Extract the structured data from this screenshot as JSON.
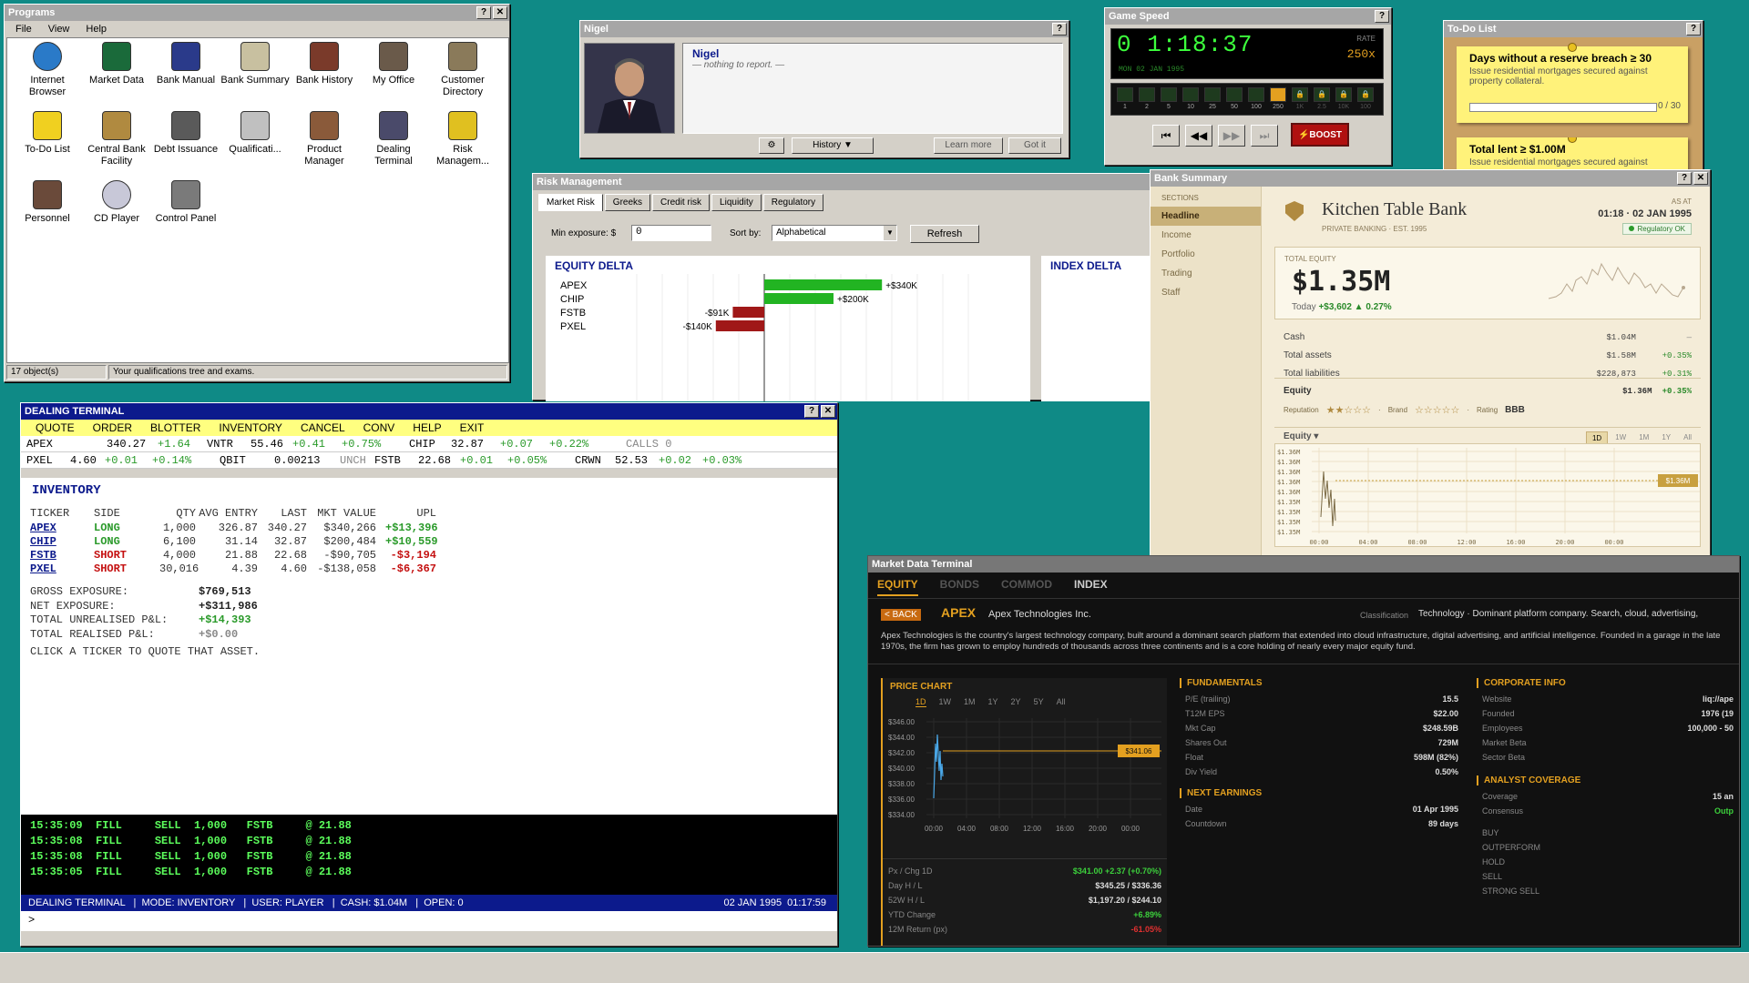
{
  "programs": {
    "title": "Programs",
    "menu": [
      "File",
      "View",
      "Help"
    ],
    "icons": [
      {
        "label": "Internet Browser",
        "icon": "globe-icon"
      },
      {
        "label": "Market Data",
        "icon": "chart-icon"
      },
      {
        "label": "Bank Manual",
        "icon": "book-icon"
      },
      {
        "label": "Bank Summary",
        "icon": "clipboard-icon"
      },
      {
        "label": "Bank History",
        "icon": "history-icon"
      },
      {
        "label": "My Office",
        "icon": "office-icon"
      },
      {
        "label": "Customer Directory",
        "icon": "directory-icon"
      },
      {
        "label": "To-Do List",
        "icon": "note-icon"
      },
      {
        "label": "Central Bank Facility",
        "icon": "bank-icon"
      },
      {
        "label": "Debt Issuance",
        "icon": "debt-icon"
      },
      {
        "label": "Qualificati...",
        "icon": "qualification-icon"
      },
      {
        "label": "Product Manager",
        "icon": "boxes-icon"
      },
      {
        "label": "Dealing Terminal",
        "icon": "terminal-icon"
      },
      {
        "label": "Risk Managem...",
        "icon": "shield-icon"
      },
      {
        "label": "Personnel",
        "icon": "people-icon"
      },
      {
        "label": "CD Player",
        "icon": "cd-icon"
      },
      {
        "label": "Control Panel",
        "icon": "gear-icon"
      }
    ],
    "status_count": "17 object(s)",
    "status_text": "Your qualifications tree and exams."
  },
  "nigel": {
    "title": "Nigel",
    "name": "Nigel",
    "message": "— nothing to report. —",
    "history": "History ▼",
    "learn": "Learn more",
    "gotit": "Got it"
  },
  "speed": {
    "title": "Game Speed",
    "time": "0 1:18:37",
    "date": "MON 02 JAN 1995",
    "rate_label": "RATE",
    "rate": "250x",
    "ticks": [
      "1",
      "2",
      "5",
      "10",
      "25",
      "50",
      "100",
      "250",
      "1K",
      "2.5",
      "10K",
      "100"
    ],
    "boost": "⚡BOOST"
  },
  "todo": {
    "title": "To-Do List",
    "item1_title": "Days without a reserve breach ≥ 30",
    "item1_desc": "Issue residential mortgages secured against property collateral.",
    "item1_progress": "0 / 30",
    "item2_title": "Total lent ≥ $1.00M",
    "item2_desc": "Issue residential mortgages secured against"
  },
  "risk": {
    "title": "Risk Management",
    "tabs": [
      "Market Risk",
      "Greeks",
      "Credit risk",
      "Liquidity",
      "Regulatory"
    ],
    "min_exposure_label": "Min exposure: $",
    "min_exposure": "0",
    "sort_label": "Sort by:",
    "sort_value": "Alphabetical",
    "refresh": "Refresh",
    "equity_title": "EQUITY DELTA",
    "index_title": "INDEX DELTA",
    "bars": [
      {
        "name": "APEX",
        "label": "+$340K",
        "value": 340
      },
      {
        "name": "CHIP",
        "label": "+$200K",
        "value": 200
      },
      {
        "name": "FSTB",
        "label": "-$91K",
        "value": -91
      },
      {
        "name": "PXEL",
        "label": "-$140K",
        "value": -140
      }
    ]
  },
  "bank": {
    "title": "Bank Summary",
    "sections_label": "SECTIONS",
    "sections": [
      "Headline",
      "Income",
      "Portfolio",
      "Trading",
      "Staff"
    ],
    "name": "Kitchen Table Bank",
    "subtitle": "PRIVATE BANKING · EST. 1995",
    "as_at_label": "AS AT",
    "as_at": "01:18 · 02 JAN 1995",
    "regulatory": "Regulatory OK",
    "total_equity_label": "TOTAL EQUITY",
    "total_equity": "$1.35M",
    "today_label": "Today",
    "today": "+$3,602 ▲ 0.27%",
    "rows": [
      {
        "k": "Cash",
        "v": "$1.04M",
        "c": "—"
      },
      {
        "k": "Total assets",
        "v": "$1.58M",
        "c": "+0.35%"
      },
      {
        "k": "Total liabilities",
        "v": "$228,873",
        "c": "+0.31%"
      }
    ],
    "equity_label": "Equity",
    "equity_v": "$1.36M",
    "equity_c": "+0.35%",
    "reputation_label": "Reputation",
    "reputation_stars": "★★☆☆☆",
    "brand_label": "Brand",
    "brand_stars": "☆☆☆☆☆",
    "rating_label": "Rating",
    "rating": "BBB",
    "chart_label": "Equity ▾",
    "ranges": [
      "1D",
      "1W",
      "1M",
      "1Y",
      "All"
    ],
    "y_ticks": [
      "$1.36M",
      "$1.36M",
      "$1.36M",
      "$1.36M",
      "$1.36M",
      "$1.35M",
      "$1.35M",
      "$1.35M",
      "$1.35M"
    ],
    "x_ticks": [
      "00:00",
      "04:00",
      "08:00",
      "12:00",
      "16:00",
      "20:00",
      "00:00"
    ],
    "last_tag": "$1.36M"
  },
  "dealing": {
    "title": "DEALING TERMINAL",
    "menu": [
      "QUOTE",
      "ORDER",
      "BLOTTER",
      "INVENTORY",
      "CANCEL",
      "CONV",
      "HELP",
      "EXIT"
    ],
    "quotes1": [
      "APEX",
      "340.27",
      "+1.64",
      "VNTR",
      "55.46",
      "+0.41",
      "+0.75%",
      "CHIP",
      "32.87",
      "+0.07",
      "+0.22%",
      "CALLS 0"
    ],
    "quotes2": [
      "PXEL",
      "4.60",
      "+0.01",
      "+0.14%",
      "QBIT",
      "0.00213",
      "UNCH",
      "FSTB",
      "22.68",
      "+0.01",
      "+0.05%",
      "CRWN",
      "52.53",
      "+0.02",
      "+0.03%"
    ],
    "inv_title": "INVENTORY",
    "headers": [
      "TICKER",
      "SIDE",
      "QTY",
      "AVG ENTRY",
      "LAST",
      "MKT VALUE",
      "UPL"
    ],
    "rows": [
      [
        "APEX",
        "LONG",
        "1,000",
        "326.87",
        "340.27",
        "$340,266",
        "+$13,396"
      ],
      [
        "CHIP",
        "LONG",
        "6,100",
        "31.14",
        "32.87",
        "$200,484",
        "+$10,559"
      ],
      [
        "FSTB",
        "SHORT",
        "4,000",
        "21.88",
        "22.68",
        "-$90,705",
        "-$3,194"
      ],
      [
        "PXEL",
        "SHORT",
        "30,016",
        "4.39",
        "4.60",
        "-$138,058",
        "-$6,367"
      ]
    ],
    "gross_label": "GROSS EXPOSURE:",
    "gross": "$769,513",
    "net_label": "NET EXPOSURE:",
    "net": "+$311,986",
    "unreal_label": "TOTAL UNREALISED P&L:",
    "unreal": "+$14,393",
    "real_label": "TOTAL REALISED P&L:",
    "real": "+$0.00",
    "hint": "CLICK A TICKER TO QUOTE THAT ASSET.",
    "log": [
      "15:35:09  FILL     SELL  1,000   FSTB     @ 21.88",
      "15:35:08  FILL     SELL  1,000   FSTB     @ 21.88",
      "15:35:08  FILL     SELL  1,000   FSTB     @ 21.88",
      "15:35:05  FILL     SELL  1,000   FSTB     @ 21.88"
    ],
    "status": "DEALING TERMINAL   |  MODE: INVENTORY   |  USER: PLAYER   |  CASH: $1.04M   |  OPEN: 0",
    "status_time": "02 JAN 1995  01:17:59",
    "prompt": ">"
  },
  "market": {
    "title": "Market Data Terminal",
    "tabs": [
      "EQUITY",
      "BONDS",
      "COMMOD",
      "INDEX"
    ],
    "back": "< BACK",
    "ticker": "APEX",
    "company": "Apex Technologies Inc.",
    "class_label": "Classification",
    "classification": "Technology · Dominant platform company. Search, cloud, advertising,",
    "description": "Apex Technologies is the country's largest technology company, built around a dominant search platform that extended into cloud infrastructure, digital advertising, and artificial intelligence. Founded in a garage in the late 1970s, the firm has grown to employ hundreds of thousands across three continents and is a core holding of nearly every major equity fund.",
    "price_chart": "PRICE CHART",
    "ranges": [
      "1D",
      "1W",
      "1M",
      "1Y",
      "2Y",
      "5Y",
      "All"
    ],
    "y_ticks": [
      "$346.00",
      "$344.00",
      "$342.00",
      "$340.00",
      "$338.00",
      "$336.00",
      "$334.00"
    ],
    "x_ticks": [
      "00:00",
      "04:00",
      "08:00",
      "12:00",
      "16:00",
      "20:00",
      "00:00"
    ],
    "last_tag": "$341.06",
    "px": [
      {
        "k": "Px / Chg 1D",
        "v": "$341.00 +2.37 (+0.70%)"
      },
      {
        "k": "Day H / L",
        "v": "$345.25 / $336.36"
      },
      {
        "k": "52W H / L",
        "v": "$1,197.20 / $244.10"
      },
      {
        "k": "YTD Change",
        "v": "+6.89%"
      },
      {
        "k": "12M Return (px)",
        "v": "-61.05%"
      }
    ],
    "fundamentals": "FUNDAMENTALS",
    "fund": [
      {
        "k": "P/E (trailing)",
        "v": "15.5"
      },
      {
        "k": "T12M EPS",
        "v": "$22.00"
      },
      {
        "k": "Mkt Cap",
        "v": "$248.59B"
      },
      {
        "k": "Shares Out",
        "v": "729M"
      },
      {
        "k": "Float",
        "v": "598M (82%)"
      },
      {
        "k": "Div Yield",
        "v": "0.50%"
      }
    ],
    "earnings": "NEXT EARNINGS",
    "earn": [
      {
        "k": "Date",
        "v": "01 Apr 1995"
      },
      {
        "k": "Countdown",
        "v": "89 days"
      }
    ],
    "corp": "CORPORATE INFO",
    "corp_rows": [
      {
        "k": "Website",
        "v": "liq://ape"
      },
      {
        "k": "Founded",
        "v": "1976 (19"
      },
      {
        "k": "Employees",
        "v": "100,000 - 50"
      },
      {
        "k": "Market Beta",
        "v": ""
      },
      {
        "k": "Sector Beta",
        "v": ""
      }
    ],
    "analyst": "ANALYST COVERAGE",
    "analyst_rows": [
      {
        "k": "Coverage",
        "v": "15 an"
      },
      {
        "k": "Consensus",
        "v": "Outp"
      }
    ],
    "ratings": [
      "BUY",
      "OUTPERFORM",
      "HOLD",
      "SELL",
      "STRONG SELL"
    ]
  }
}
